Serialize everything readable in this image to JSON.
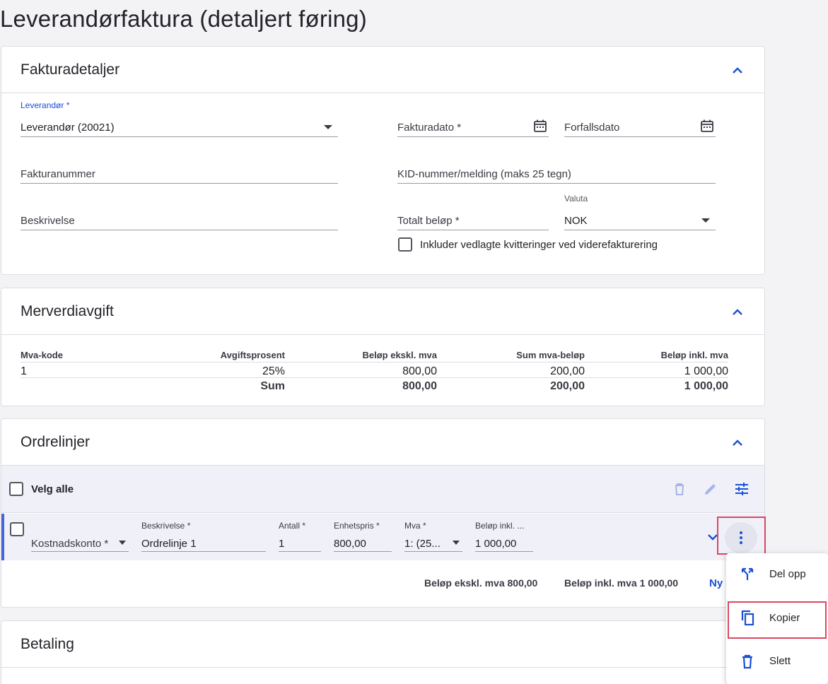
{
  "page": {
    "title": "Leverandørfaktura (detaljert føring)"
  },
  "invoice_details": {
    "title": "Fakturadetaljer",
    "supplier": {
      "label": "Leverandør *",
      "value": "Leverandør (20021)"
    },
    "invoice_date": {
      "label": "Fakturadato *"
    },
    "due_date": {
      "label": "Forfallsdato"
    },
    "invoice_number": {
      "label": "Fakturanummer"
    },
    "kid": {
      "label": "KID-nummer/melding (maks 25 tegn)"
    },
    "description": {
      "label": "Beskrivelse"
    },
    "total_amount": {
      "label": "Totalt beløp *"
    },
    "currency": {
      "label": "Valuta",
      "value": "NOK"
    },
    "include_receipts": {
      "label": "Inkluder vedlagte kvitteringer ved viderefakturering"
    }
  },
  "vat": {
    "title": "Merverdiavgift",
    "headers": [
      "Mva-kode",
      "Avgiftsprosent",
      "Beløp ekskl. mva",
      "Sum mva-beløp",
      "Beløp inkl. mva"
    ],
    "rows": [
      [
        "1",
        "25%",
        "800,00",
        "200,00",
        "1 000,00"
      ]
    ],
    "sum": [
      "",
      "Sum",
      "800,00",
      "200,00",
      "1 000,00"
    ]
  },
  "order_lines": {
    "title": "Ordrelinjer",
    "select_all": "Velg alle",
    "line": {
      "account": {
        "label": "Kostnadskonto *"
      },
      "description": {
        "label": "Beskrivelse *",
        "value": "Ordrelinje 1"
      },
      "quantity": {
        "label": "Antall *",
        "value": "1"
      },
      "unit_price": {
        "label": "Enhetspris *",
        "value": "800,00"
      },
      "vat": {
        "label": "Mva *",
        "value": "1: (25..."
      },
      "amount_incl": {
        "label": "Beløp inkl. ...",
        "value": "1 000,00"
      }
    },
    "totals": {
      "excl": "Beløp ekskl. mva 800,00",
      "incl": "Beløp inkl. mva 1 000,00",
      "new_link": "Ny"
    }
  },
  "payment": {
    "title": "Betaling"
  },
  "context_menu": {
    "items": [
      {
        "label": "Del opp",
        "icon": "split-icon"
      },
      {
        "label": "Kopier",
        "icon": "copy-icon"
      },
      {
        "label": "Slett",
        "icon": "trash-icon"
      }
    ]
  },
  "colors": {
    "accent": "#1a4fd6",
    "highlight": "#d9485f",
    "row_bg": "#eff0f8"
  }
}
